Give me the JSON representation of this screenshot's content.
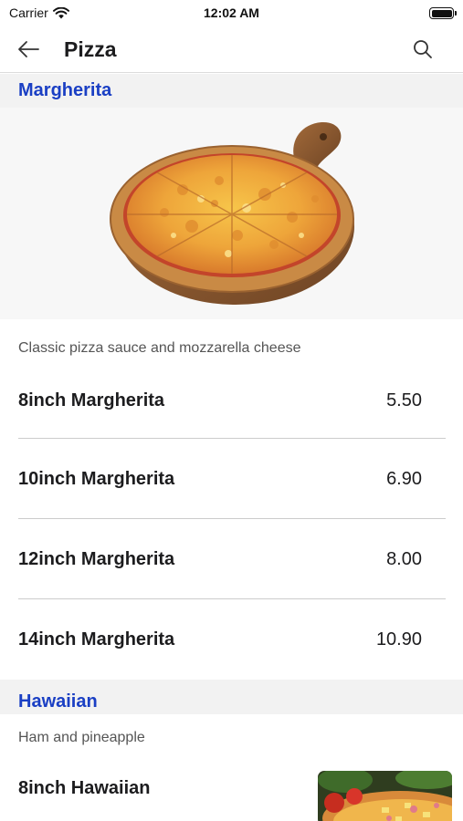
{
  "status_bar": {
    "carrier": "Carrier",
    "time": "12:02 AM"
  },
  "nav": {
    "title": "Pizza",
    "back_icon": "arrow-left-icon",
    "search_icon": "search-icon"
  },
  "colors": {
    "section_title": "#1a3fc4",
    "section_background": "#f2f2f2",
    "divider": "#cccccc"
  },
  "sections": [
    {
      "title": "Margherita",
      "description": "Classic pizza sauce and mozzarella cheese",
      "image": "margherita-pizza-image",
      "items": [
        {
          "name": "8inch Margherita",
          "price": "5.50"
        },
        {
          "name": "10inch Margherita",
          "price": "6.90"
        },
        {
          "name": "12inch Margherita",
          "price": "8.00"
        },
        {
          "name": "14inch Margherita",
          "price": "10.90"
        }
      ]
    },
    {
      "title": "Hawaiian",
      "description": "Ham and pineapple",
      "image": "hawaiian-pizza-image",
      "items": [
        {
          "name": "8inch Hawaiian"
        }
      ]
    }
  ]
}
